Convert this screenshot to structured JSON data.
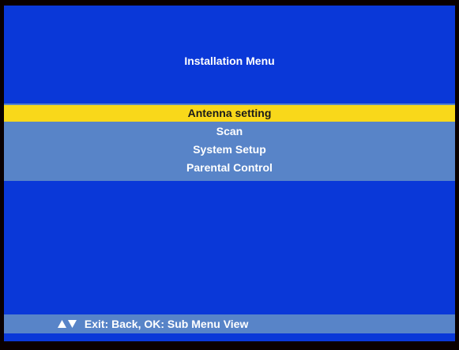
{
  "title": "Installation Menu",
  "menu": {
    "items": [
      {
        "label": "Antenna setting",
        "selected": true
      },
      {
        "label": "Scan",
        "selected": false
      },
      {
        "label": "System Setup",
        "selected": false
      },
      {
        "label": "Parental Control",
        "selected": false
      }
    ]
  },
  "footer": {
    "icon": "up-down-arrows-icon",
    "hint": "Exit: Back, OK: Sub Menu View"
  },
  "colors": {
    "background": "#0a38d8",
    "menu_band": "#5884c8",
    "highlight": "#f9d81a"
  }
}
